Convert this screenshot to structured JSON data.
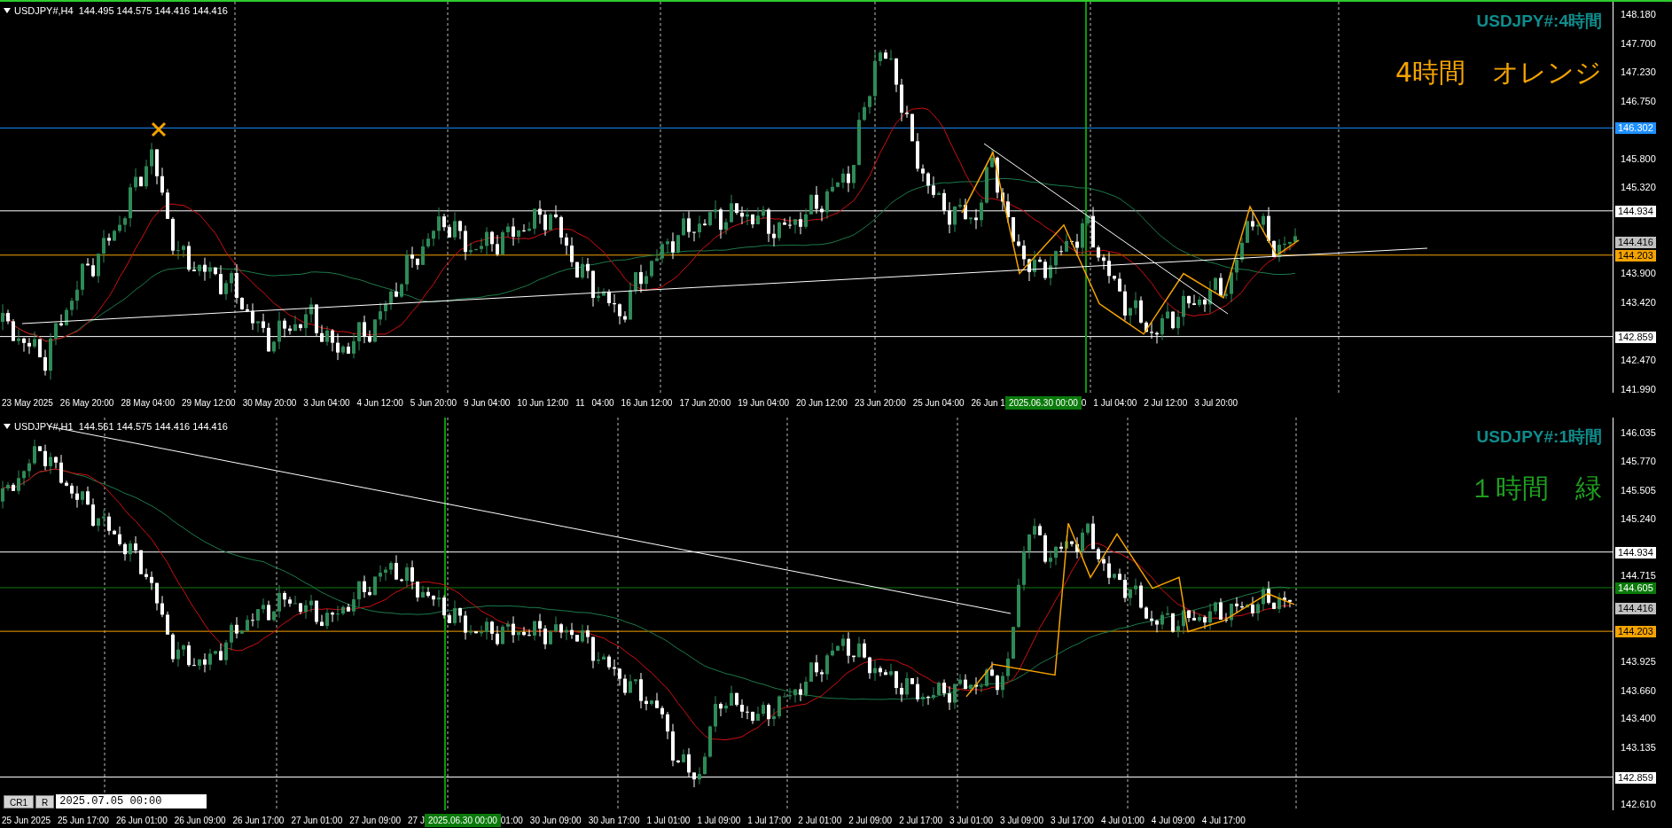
{
  "charts": [
    {
      "active": true,
      "header": "USDJPY#,H4  144.495 144.575 144.416 144.416",
      "symbol_title": "USDJPY#:4時間",
      "note": "4時間　オレンジ",
      "color": "#f5a300",
      "price_ticks": [
        "148.180",
        "147.700",
        "147.230",
        "146.750",
        "145.800",
        "145.320",
        "143.900",
        "143.420",
        "142.470",
        "141.990"
      ],
      "price_lines": [
        {
          "label": "146.302",
          "color": "#1e90ff",
          "line": true
        },
        {
          "label": "144.934",
          "color": "#ffffff",
          "line": true
        },
        {
          "label": "144.416",
          "color": "#c0c0c0",
          "line": false
        },
        {
          "label": "144.203",
          "color": "#f5a300",
          "line": true
        },
        {
          "label": "142.859",
          "color": "#ffffff",
          "line": true
        }
      ],
      "time_labels": [
        {
          "text": "23 May 2025",
          "kind": "tick"
        },
        {
          "text": "26 May 20:00",
          "kind": "tick"
        },
        {
          "text": "28 May 04:00",
          "kind": "tick"
        },
        {
          "text": "29 May 12:00",
          "kind": "tick"
        },
        {
          "text": "30 May 20:00",
          "kind": "tick"
        },
        {
          "text": "3 Jun 04:00",
          "kind": "tick"
        },
        {
          "text": "4 Jun 12:00",
          "kind": "tick"
        },
        {
          "text": "5 Jun 20:00",
          "kind": "tick"
        },
        {
          "text": "9 Jun 04:00",
          "kind": "tick"
        },
        {
          "text": "10 Jun 12:00",
          "kind": "tick"
        },
        {
          "text": "11",
          "kind": "tick"
        },
        {
          "text": "04:00",
          "kind": "tick"
        },
        {
          "text": "16 Jun 12:00",
          "kind": "tick"
        },
        {
          "text": "17 Jun 20:00",
          "kind": "tick"
        },
        {
          "text": "19 Jun 04:00",
          "kind": "tick"
        },
        {
          "text": "20 Jun 12:00",
          "kind": "tick"
        },
        {
          "text": "23 Jun 20:00",
          "kind": "tick"
        },
        {
          "text": "25 Jun 04:00",
          "kind": "tick"
        },
        {
          "text": "26 Jun 1",
          "kind": "tick"
        },
        {
          "text": "2025.06.30 00:00",
          "kind": "crosshair"
        },
        {
          "text": "0",
          "kind": "tick"
        },
        {
          "text": "1 Jul 04:00",
          "kind": "tick"
        },
        {
          "text": "2 Jul 12:00",
          "kind": "tick"
        },
        {
          "text": "3 Jul 20:00",
          "kind": "tick"
        }
      ]
    },
    {
      "active": false,
      "header": "USDJPY#,H1  144.561 144.575 144.416 144.416",
      "symbol_title": "USDJPY#:1時間",
      "note": "１時間　緑",
      "color": "#1f9e1f",
      "price_ticks": [
        "146.035",
        "145.770",
        "145.505",
        "145.240",
        "144.715",
        "143.925",
        "143.660",
        "143.400",
        "143.135",
        "142.610"
      ],
      "price_lines": [
        {
          "label": "144.934",
          "color": "#ffffff",
          "line": true
        },
        {
          "label": "144.605",
          "color": "#0a7a0a",
          "line": true
        },
        {
          "label": "144.416",
          "color": "#c0c0c0",
          "line": false
        },
        {
          "label": "144.203",
          "color": "#f5a300",
          "line": true
        },
        {
          "label": "142.859",
          "color": "#ffffff",
          "line": true
        }
      ],
      "time_labels": [
        {
          "text": "25 Jun 2025",
          "kind": "tick"
        },
        {
          "text": "25 Jun 17:00",
          "kind": "tick"
        },
        {
          "text": "26 Jun 01:00",
          "kind": "tick"
        },
        {
          "text": "26 Jun 09:00",
          "kind": "tick"
        },
        {
          "text": "26 Jun 17:00",
          "kind": "tick"
        },
        {
          "text": "27 Jun 01:00",
          "kind": "tick"
        },
        {
          "text": "27 Jun 09:00",
          "kind": "tick"
        },
        {
          "text": "27 J",
          "kind": "tick"
        },
        {
          "text": "2025.06.30 00:00",
          "kind": "crosshair"
        },
        {
          "text": "01:00",
          "kind": "tick"
        },
        {
          "text": "30 Jun 09:00",
          "kind": "tick"
        },
        {
          "text": "30 Jun 17:00",
          "kind": "tick"
        },
        {
          "text": "1 Jul 01:00",
          "kind": "tick"
        },
        {
          "text": "1 Jul 09:00",
          "kind": "tick"
        },
        {
          "text": "1 Jul 17:00",
          "kind": "tick"
        },
        {
          "text": "2 Jul 01:00",
          "kind": "tick"
        },
        {
          "text": "2 Jul 09:00",
          "kind": "tick"
        },
        {
          "text": "2 Jul 17:00",
          "kind": "tick"
        },
        {
          "text": "3 Jul 01:00",
          "kind": "tick"
        },
        {
          "text": "3 Jul 09:00",
          "kind": "tick"
        },
        {
          "text": "3 Jul 17:00",
          "kind": "tick"
        },
        {
          "text": "4 Jul 01:00",
          "kind": "tick"
        },
        {
          "text": "4 Jul 09:00",
          "kind": "tick"
        },
        {
          "text": "4 Jul 17:00",
          "kind": "tick"
        }
      ]
    }
  ],
  "date_bar": {
    "buttons": [
      "CR1",
      "R"
    ],
    "value": "2025.07.05 00:00"
  }
}
